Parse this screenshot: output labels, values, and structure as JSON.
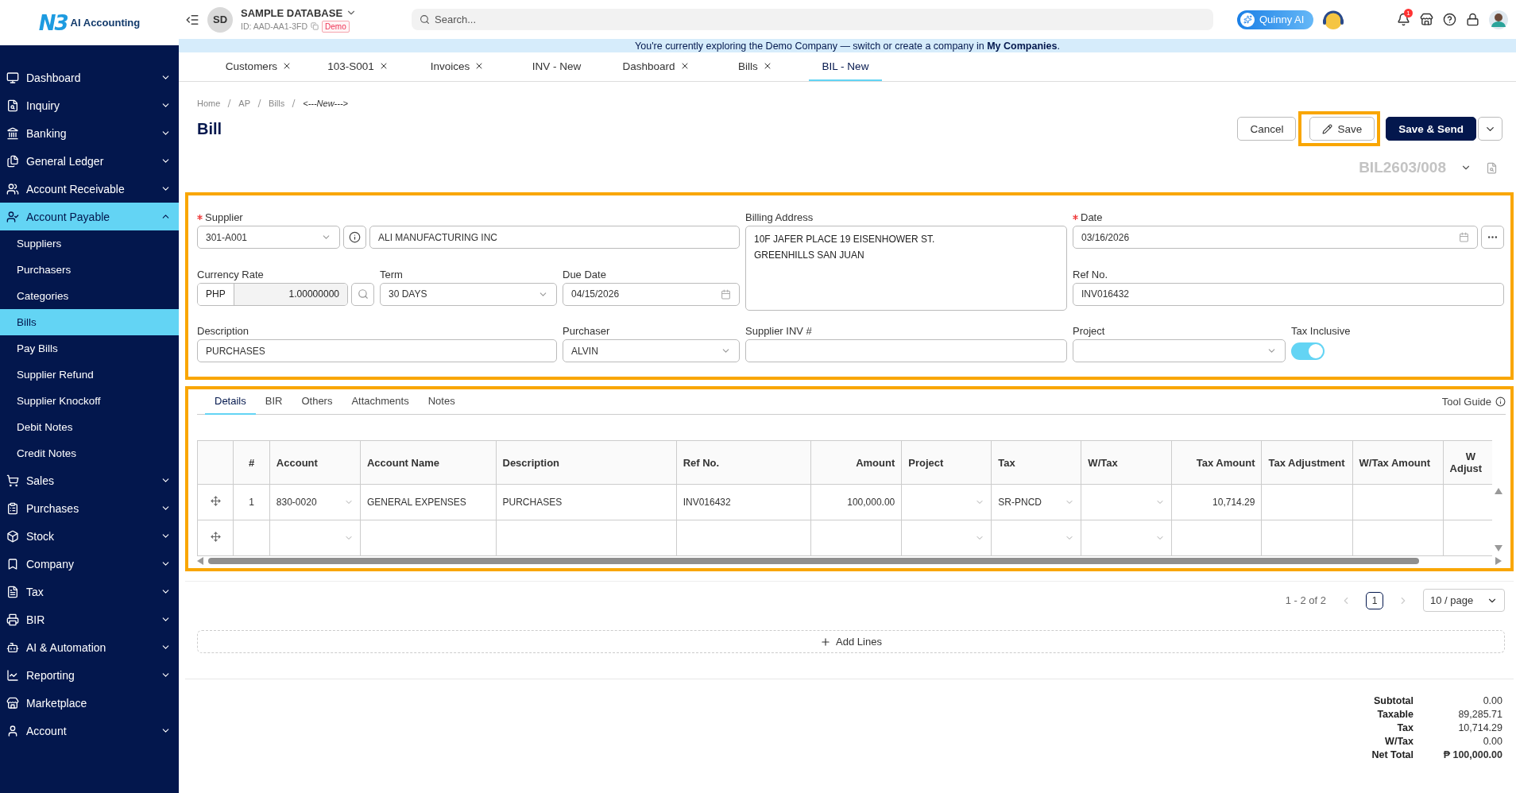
{
  "brand": {
    "mark": "N3",
    "name": "AI Accounting"
  },
  "header": {
    "avatar": "SD",
    "database": "SAMPLE DATABASE",
    "database_id": "ID: AAD-AA1-3FD",
    "badge": "Demo",
    "search_placeholder": "Search...",
    "assistant": "Quinny AI",
    "notification_count": "1"
  },
  "banner": "You're currently exploring the Demo Company — switch or create a company in **My Companies**.",
  "sidebar": [
    {
      "label": "Dashboard",
      "expanded": false,
      "selected": false
    },
    {
      "label": "Inquiry",
      "expanded": false,
      "selected": false
    },
    {
      "label": "Banking",
      "expanded": false,
      "selected": false
    },
    {
      "label": "General Ledger",
      "expanded": false,
      "selected": false
    },
    {
      "label": "Account Receivable",
      "expanded": false,
      "selected": false
    },
    {
      "label": "Account Payable",
      "expanded": true,
      "selected": true,
      "children": [
        {
          "label": "Suppliers",
          "selected": false
        },
        {
          "label": "Purchasers",
          "selected": false
        },
        {
          "label": "Categories",
          "selected": false
        },
        {
          "label": "Bills",
          "selected": true
        },
        {
          "label": "Pay Bills",
          "selected": false
        },
        {
          "label": "Supplier Refund",
          "selected": false
        },
        {
          "label": "Supplier Knockoff",
          "selected": false
        },
        {
          "label": "Debit Notes",
          "selected": false
        },
        {
          "label": "Credit Notes",
          "selected": false
        }
      ]
    },
    {
      "label": "Sales",
      "expanded": false,
      "selected": false
    },
    {
      "label": "Purchases",
      "expanded": false,
      "selected": false
    },
    {
      "label": "Stock",
      "expanded": false,
      "selected": false
    },
    {
      "label": "Company",
      "expanded": false,
      "selected": false
    },
    {
      "label": "Tax",
      "expanded": false,
      "selected": false
    },
    {
      "label": "BIR",
      "expanded": false,
      "selected": false
    },
    {
      "label": "AI & Automation",
      "expanded": false,
      "selected": false
    },
    {
      "label": "Reporting",
      "expanded": false,
      "selected": false
    },
    {
      "label": "Marketplace",
      "selected": false
    },
    {
      "label": "Account",
      "expanded": false,
      "selected": false
    }
  ],
  "tabs": [
    {
      "label": "Customers",
      "closable": true,
      "selected": false
    },
    {
      "label": "103-S001",
      "closable": true,
      "selected": false
    },
    {
      "label": "Invoices",
      "closable": true,
      "selected": false
    },
    {
      "label": "INV - New",
      "closable": false,
      "selected": false
    },
    {
      "label": "Dashboard",
      "closable": true,
      "selected": false
    },
    {
      "label": "Bills",
      "closable": true,
      "selected": false
    },
    {
      "label": "BIL - New",
      "closable": false,
      "selected": true
    }
  ],
  "breadcrumb": [
    "Home",
    "AP",
    "Bills",
    "<---New--->"
  ],
  "title": "Bill",
  "actions": [
    {
      "label": "Cancel",
      "kind": "outline",
      "highlighted": false
    },
    {
      "label": "Save",
      "kind": "edit",
      "highlighted": true
    },
    {
      "label": "Save & Send",
      "kind": "primary",
      "highlighted": false
    },
    {
      "kind": "caret",
      "highlighted": false
    }
  ],
  "document_number": "BIL2603/008",
  "form": {
    "highlighted": true,
    "fields": [
      {
        "label": "Supplier",
        "required": true,
        "kind": "supplier",
        "code": "301-A001",
        "value": "ALI MANUFACTURING INC"
      },
      {
        "label": "Billing Address",
        "required": false,
        "kind": "textarea",
        "value": "10F JAFER PLACE 19 EISENHOWER ST.\nGREENHILLS SAN JUAN"
      },
      {
        "label": "Date",
        "required": true,
        "kind": "date-more",
        "value": "03/16/2026"
      },
      {
        "label": "Currency Rate",
        "required": false,
        "kind": "currency",
        "currency": "PHP",
        "value": "1.00000000"
      },
      {
        "label": "Term",
        "required": false,
        "kind": "select",
        "value": "30 DAYS"
      },
      {
        "label": "Due Date",
        "required": false,
        "kind": "date",
        "value": "04/15/2026"
      },
      {
        "label": "Ref No.",
        "required": false,
        "kind": "text",
        "value": "INV016432"
      },
      {
        "label": "Description",
        "required": false,
        "kind": "text",
        "value": "PURCHASES"
      },
      {
        "label": "Purchaser",
        "required": false,
        "kind": "select",
        "value": "ALVIN"
      },
      {
        "label": "Supplier INV #",
        "required": false,
        "kind": "text"
      },
      {
        "label": "Project",
        "required": false,
        "kind": "select"
      },
      {
        "label": "Tax Inclusive",
        "required": false,
        "kind": "toggle",
        "on": true
      }
    ]
  },
  "details": {
    "highlighted": true,
    "tabs": [
      {
        "label": "Details",
        "selected": true
      },
      {
        "label": "BIR",
        "selected": false
      },
      {
        "label": "Others",
        "selected": false
      },
      {
        "label": "Attachments",
        "selected": false
      },
      {
        "label": "Notes",
        "selected": false
      }
    ],
    "tool_guide": "Tool Guide",
    "columns": [
      {
        "kind": "handle"
      },
      {
        "label": "#",
        "kind": "center"
      },
      {
        "label": "Account",
        "kind": "select"
      },
      {
        "label": "Account Name",
        "kind": "text"
      },
      {
        "label": "Description",
        "kind": "text"
      },
      {
        "label": "Ref No.",
        "kind": "text"
      },
      {
        "label": "Amount",
        "kind": "number"
      },
      {
        "label": "Project",
        "kind": "select"
      },
      {
        "label": "Tax",
        "kind": "select"
      },
      {
        "label": "W/Tax",
        "kind": "select"
      },
      {
        "label": "Tax Amount",
        "kind": "number"
      },
      {
        "label": "Tax Adjustment",
        "kind": "text"
      },
      {
        "label": "W/Tax Amount",
        "kind": "text"
      },
      {
        "label": "W Adjust",
        "kind": "cut"
      }
    ],
    "rows": [
      {
        "cells": [
          "",
          "1",
          "830-0020",
          "GENERAL EXPENSES",
          "PURCHASES",
          "INV016432",
          "100,000.00",
          "",
          "SR-PNCD",
          "",
          "10,714.29",
          "",
          "",
          ""
        ]
      },
      {
        "cells": [
          "",
          "",
          "",
          "",
          "",
          "",
          "",
          "",
          "",
          "",
          "",
          "",
          "",
          ""
        ]
      }
    ]
  },
  "pagination": {
    "range": "1 - 2 of 2",
    "pages": [
      {
        "label": "1",
        "selected": true
      }
    ],
    "page_size": "10 / page"
  },
  "add_lines": "Add Lines",
  "totals": [
    {
      "label": "Subtotal",
      "value": "0.00",
      "bold": false
    },
    {
      "label": "Taxable",
      "value": "89,285.71",
      "bold": false
    },
    {
      "label": "Tax",
      "value": "10,714.29",
      "bold": false
    },
    {
      "label": "W/Tax",
      "value": "0.00",
      "bold": false
    },
    {
      "label": "Net Total",
      "value": "₱ 100,000.00",
      "bold": true
    }
  ]
}
